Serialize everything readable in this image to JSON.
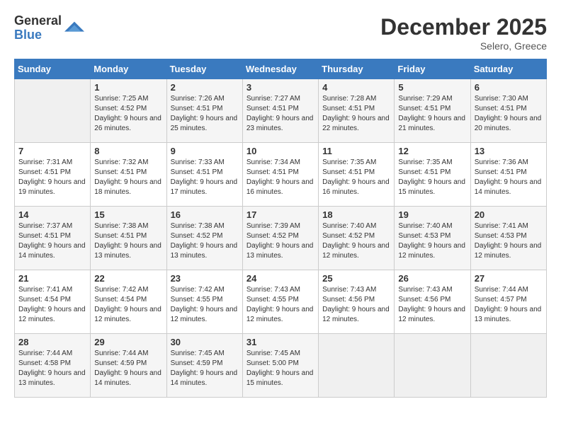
{
  "logo": {
    "general": "General",
    "blue": "Blue"
  },
  "title": {
    "month_year": "December 2025",
    "location": "Selero, Greece"
  },
  "days_of_week": [
    "Sunday",
    "Monday",
    "Tuesday",
    "Wednesday",
    "Thursday",
    "Friday",
    "Saturday"
  ],
  "weeks": [
    [
      {
        "day": "",
        "sunrise": "",
        "sunset": "",
        "daylight": ""
      },
      {
        "day": "1",
        "sunrise": "Sunrise: 7:25 AM",
        "sunset": "Sunset: 4:52 PM",
        "daylight": "Daylight: 9 hours and 26 minutes."
      },
      {
        "day": "2",
        "sunrise": "Sunrise: 7:26 AM",
        "sunset": "Sunset: 4:51 PM",
        "daylight": "Daylight: 9 hours and 25 minutes."
      },
      {
        "day": "3",
        "sunrise": "Sunrise: 7:27 AM",
        "sunset": "Sunset: 4:51 PM",
        "daylight": "Daylight: 9 hours and 23 minutes."
      },
      {
        "day": "4",
        "sunrise": "Sunrise: 7:28 AM",
        "sunset": "Sunset: 4:51 PM",
        "daylight": "Daylight: 9 hours and 22 minutes."
      },
      {
        "day": "5",
        "sunrise": "Sunrise: 7:29 AM",
        "sunset": "Sunset: 4:51 PM",
        "daylight": "Daylight: 9 hours and 21 minutes."
      },
      {
        "day": "6",
        "sunrise": "Sunrise: 7:30 AM",
        "sunset": "Sunset: 4:51 PM",
        "daylight": "Daylight: 9 hours and 20 minutes."
      }
    ],
    [
      {
        "day": "7",
        "sunrise": "Sunrise: 7:31 AM",
        "sunset": "Sunset: 4:51 PM",
        "daylight": "Daylight: 9 hours and 19 minutes."
      },
      {
        "day": "8",
        "sunrise": "Sunrise: 7:32 AM",
        "sunset": "Sunset: 4:51 PM",
        "daylight": "Daylight: 9 hours and 18 minutes."
      },
      {
        "day": "9",
        "sunrise": "Sunrise: 7:33 AM",
        "sunset": "Sunset: 4:51 PM",
        "daylight": "Daylight: 9 hours and 17 minutes."
      },
      {
        "day": "10",
        "sunrise": "Sunrise: 7:34 AM",
        "sunset": "Sunset: 4:51 PM",
        "daylight": "Daylight: 9 hours and 16 minutes."
      },
      {
        "day": "11",
        "sunrise": "Sunrise: 7:35 AM",
        "sunset": "Sunset: 4:51 PM",
        "daylight": "Daylight: 9 hours and 16 minutes."
      },
      {
        "day": "12",
        "sunrise": "Sunrise: 7:35 AM",
        "sunset": "Sunset: 4:51 PM",
        "daylight": "Daylight: 9 hours and 15 minutes."
      },
      {
        "day": "13",
        "sunrise": "Sunrise: 7:36 AM",
        "sunset": "Sunset: 4:51 PM",
        "daylight": "Daylight: 9 hours and 14 minutes."
      }
    ],
    [
      {
        "day": "14",
        "sunrise": "Sunrise: 7:37 AM",
        "sunset": "Sunset: 4:51 PM",
        "daylight": "Daylight: 9 hours and 14 minutes."
      },
      {
        "day": "15",
        "sunrise": "Sunrise: 7:38 AM",
        "sunset": "Sunset: 4:51 PM",
        "daylight": "Daylight: 9 hours and 13 minutes."
      },
      {
        "day": "16",
        "sunrise": "Sunrise: 7:38 AM",
        "sunset": "Sunset: 4:52 PM",
        "daylight": "Daylight: 9 hours and 13 minutes."
      },
      {
        "day": "17",
        "sunrise": "Sunrise: 7:39 AM",
        "sunset": "Sunset: 4:52 PM",
        "daylight": "Daylight: 9 hours and 13 minutes."
      },
      {
        "day": "18",
        "sunrise": "Sunrise: 7:40 AM",
        "sunset": "Sunset: 4:52 PM",
        "daylight": "Daylight: 9 hours and 12 minutes."
      },
      {
        "day": "19",
        "sunrise": "Sunrise: 7:40 AM",
        "sunset": "Sunset: 4:53 PM",
        "daylight": "Daylight: 9 hours and 12 minutes."
      },
      {
        "day": "20",
        "sunrise": "Sunrise: 7:41 AM",
        "sunset": "Sunset: 4:53 PM",
        "daylight": "Daylight: 9 hours and 12 minutes."
      }
    ],
    [
      {
        "day": "21",
        "sunrise": "Sunrise: 7:41 AM",
        "sunset": "Sunset: 4:54 PM",
        "daylight": "Daylight: 9 hours and 12 minutes."
      },
      {
        "day": "22",
        "sunrise": "Sunrise: 7:42 AM",
        "sunset": "Sunset: 4:54 PM",
        "daylight": "Daylight: 9 hours and 12 minutes."
      },
      {
        "day": "23",
        "sunrise": "Sunrise: 7:42 AM",
        "sunset": "Sunset: 4:55 PM",
        "daylight": "Daylight: 9 hours and 12 minutes."
      },
      {
        "day": "24",
        "sunrise": "Sunrise: 7:43 AM",
        "sunset": "Sunset: 4:55 PM",
        "daylight": "Daylight: 9 hours and 12 minutes."
      },
      {
        "day": "25",
        "sunrise": "Sunrise: 7:43 AM",
        "sunset": "Sunset: 4:56 PM",
        "daylight": "Daylight: 9 hours and 12 minutes."
      },
      {
        "day": "26",
        "sunrise": "Sunrise: 7:43 AM",
        "sunset": "Sunset: 4:56 PM",
        "daylight": "Daylight: 9 hours and 12 minutes."
      },
      {
        "day": "27",
        "sunrise": "Sunrise: 7:44 AM",
        "sunset": "Sunset: 4:57 PM",
        "daylight": "Daylight: 9 hours and 13 minutes."
      }
    ],
    [
      {
        "day": "28",
        "sunrise": "Sunrise: 7:44 AM",
        "sunset": "Sunset: 4:58 PM",
        "daylight": "Daylight: 9 hours and 13 minutes."
      },
      {
        "day": "29",
        "sunrise": "Sunrise: 7:44 AM",
        "sunset": "Sunset: 4:59 PM",
        "daylight": "Daylight: 9 hours and 14 minutes."
      },
      {
        "day": "30",
        "sunrise": "Sunrise: 7:45 AM",
        "sunset": "Sunset: 4:59 PM",
        "daylight": "Daylight: 9 hours and 14 minutes."
      },
      {
        "day": "31",
        "sunrise": "Sunrise: 7:45 AM",
        "sunset": "Sunset: 5:00 PM",
        "daylight": "Daylight: 9 hours and 15 minutes."
      },
      {
        "day": "",
        "sunrise": "",
        "sunset": "",
        "daylight": ""
      },
      {
        "day": "",
        "sunrise": "",
        "sunset": "",
        "daylight": ""
      },
      {
        "day": "",
        "sunrise": "",
        "sunset": "",
        "daylight": ""
      }
    ]
  ]
}
